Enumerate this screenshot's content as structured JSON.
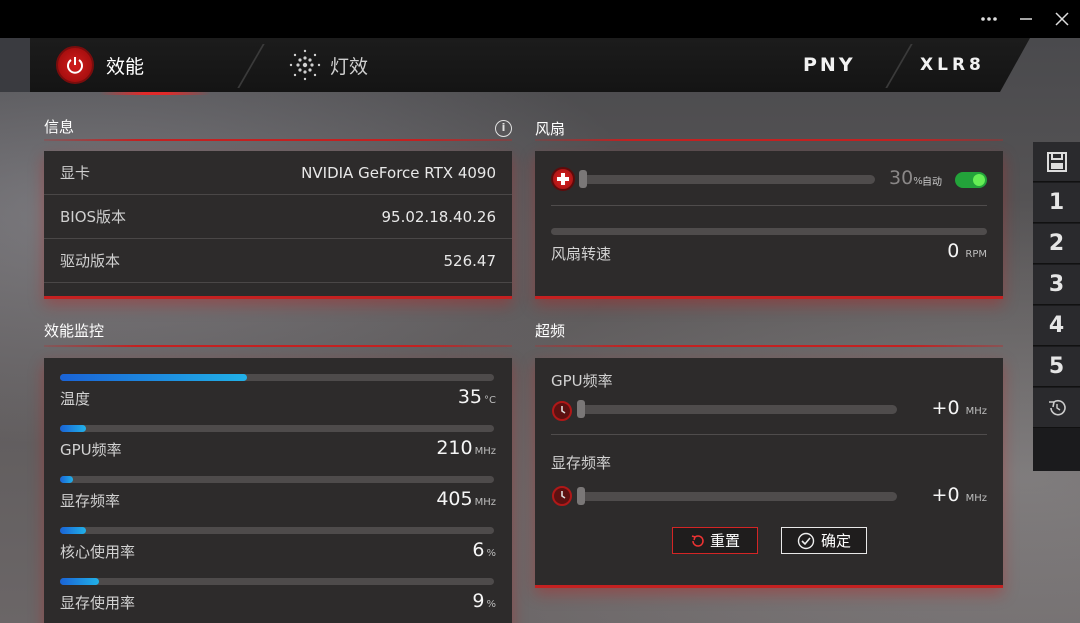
{
  "window": {
    "more_icon": "more-dots-icon",
    "minimize_icon": "minimize-icon",
    "close_icon": "close-icon"
  },
  "header": {
    "tabs": [
      {
        "label": "效能",
        "icon": "power-icon",
        "active": true
      },
      {
        "label": "灯效",
        "icon": "light-dots-icon",
        "active": false
      }
    ],
    "brand_left": "PNY",
    "brand_right": "XLR8"
  },
  "info": {
    "title": "信息",
    "rows": [
      {
        "label": "显卡",
        "value": "NVIDIA GeForce RTX 4090"
      },
      {
        "label": "BIOS版本",
        "value": "95.02.18.40.26"
      },
      {
        "label": "驱动版本",
        "value": "526.47"
      }
    ]
  },
  "fan": {
    "title": "风扇",
    "percent": "30",
    "percent_unit": "%",
    "auto_label": "自动",
    "auto_enabled": true,
    "speed_label": "风扇转速",
    "speed_value": "0",
    "speed_unit": "RPM"
  },
  "monitor": {
    "title": "效能监控",
    "items": [
      {
        "label": "温度",
        "value": "35",
        "unit": "°C",
        "fill": 0.43
      },
      {
        "label": "GPU频率",
        "value": "210",
        "unit": "MHz",
        "fill": 0.06
      },
      {
        "label": "显存频率",
        "value": "405",
        "unit": "MHz",
        "fill": 0.03
      },
      {
        "label": "核心使用率",
        "value": "6",
        "unit": "%",
        "fill": 0.06
      },
      {
        "label": "显存使用率",
        "value": "9",
        "unit": "%",
        "fill": 0.09
      }
    ]
  },
  "overclock": {
    "title": "超频",
    "gpu_label": "GPU频率",
    "gpu_value": "+0",
    "gpu_unit": "MHz",
    "mem_label": "显存频率",
    "mem_value": "+0",
    "mem_unit": "MHz",
    "reset_label": "重置",
    "confirm_label": "确定"
  },
  "profiles": {
    "save_icon": "save-icon",
    "items": [
      "1",
      "2",
      "3",
      "4",
      "5"
    ],
    "reset_icon": "history-reset-icon"
  },
  "colors": {
    "accent_red": "#c42121",
    "bar_blue": "#1a63d6",
    "bar_cyan": "#21b1e8",
    "toggle_green": "#23a33a"
  }
}
